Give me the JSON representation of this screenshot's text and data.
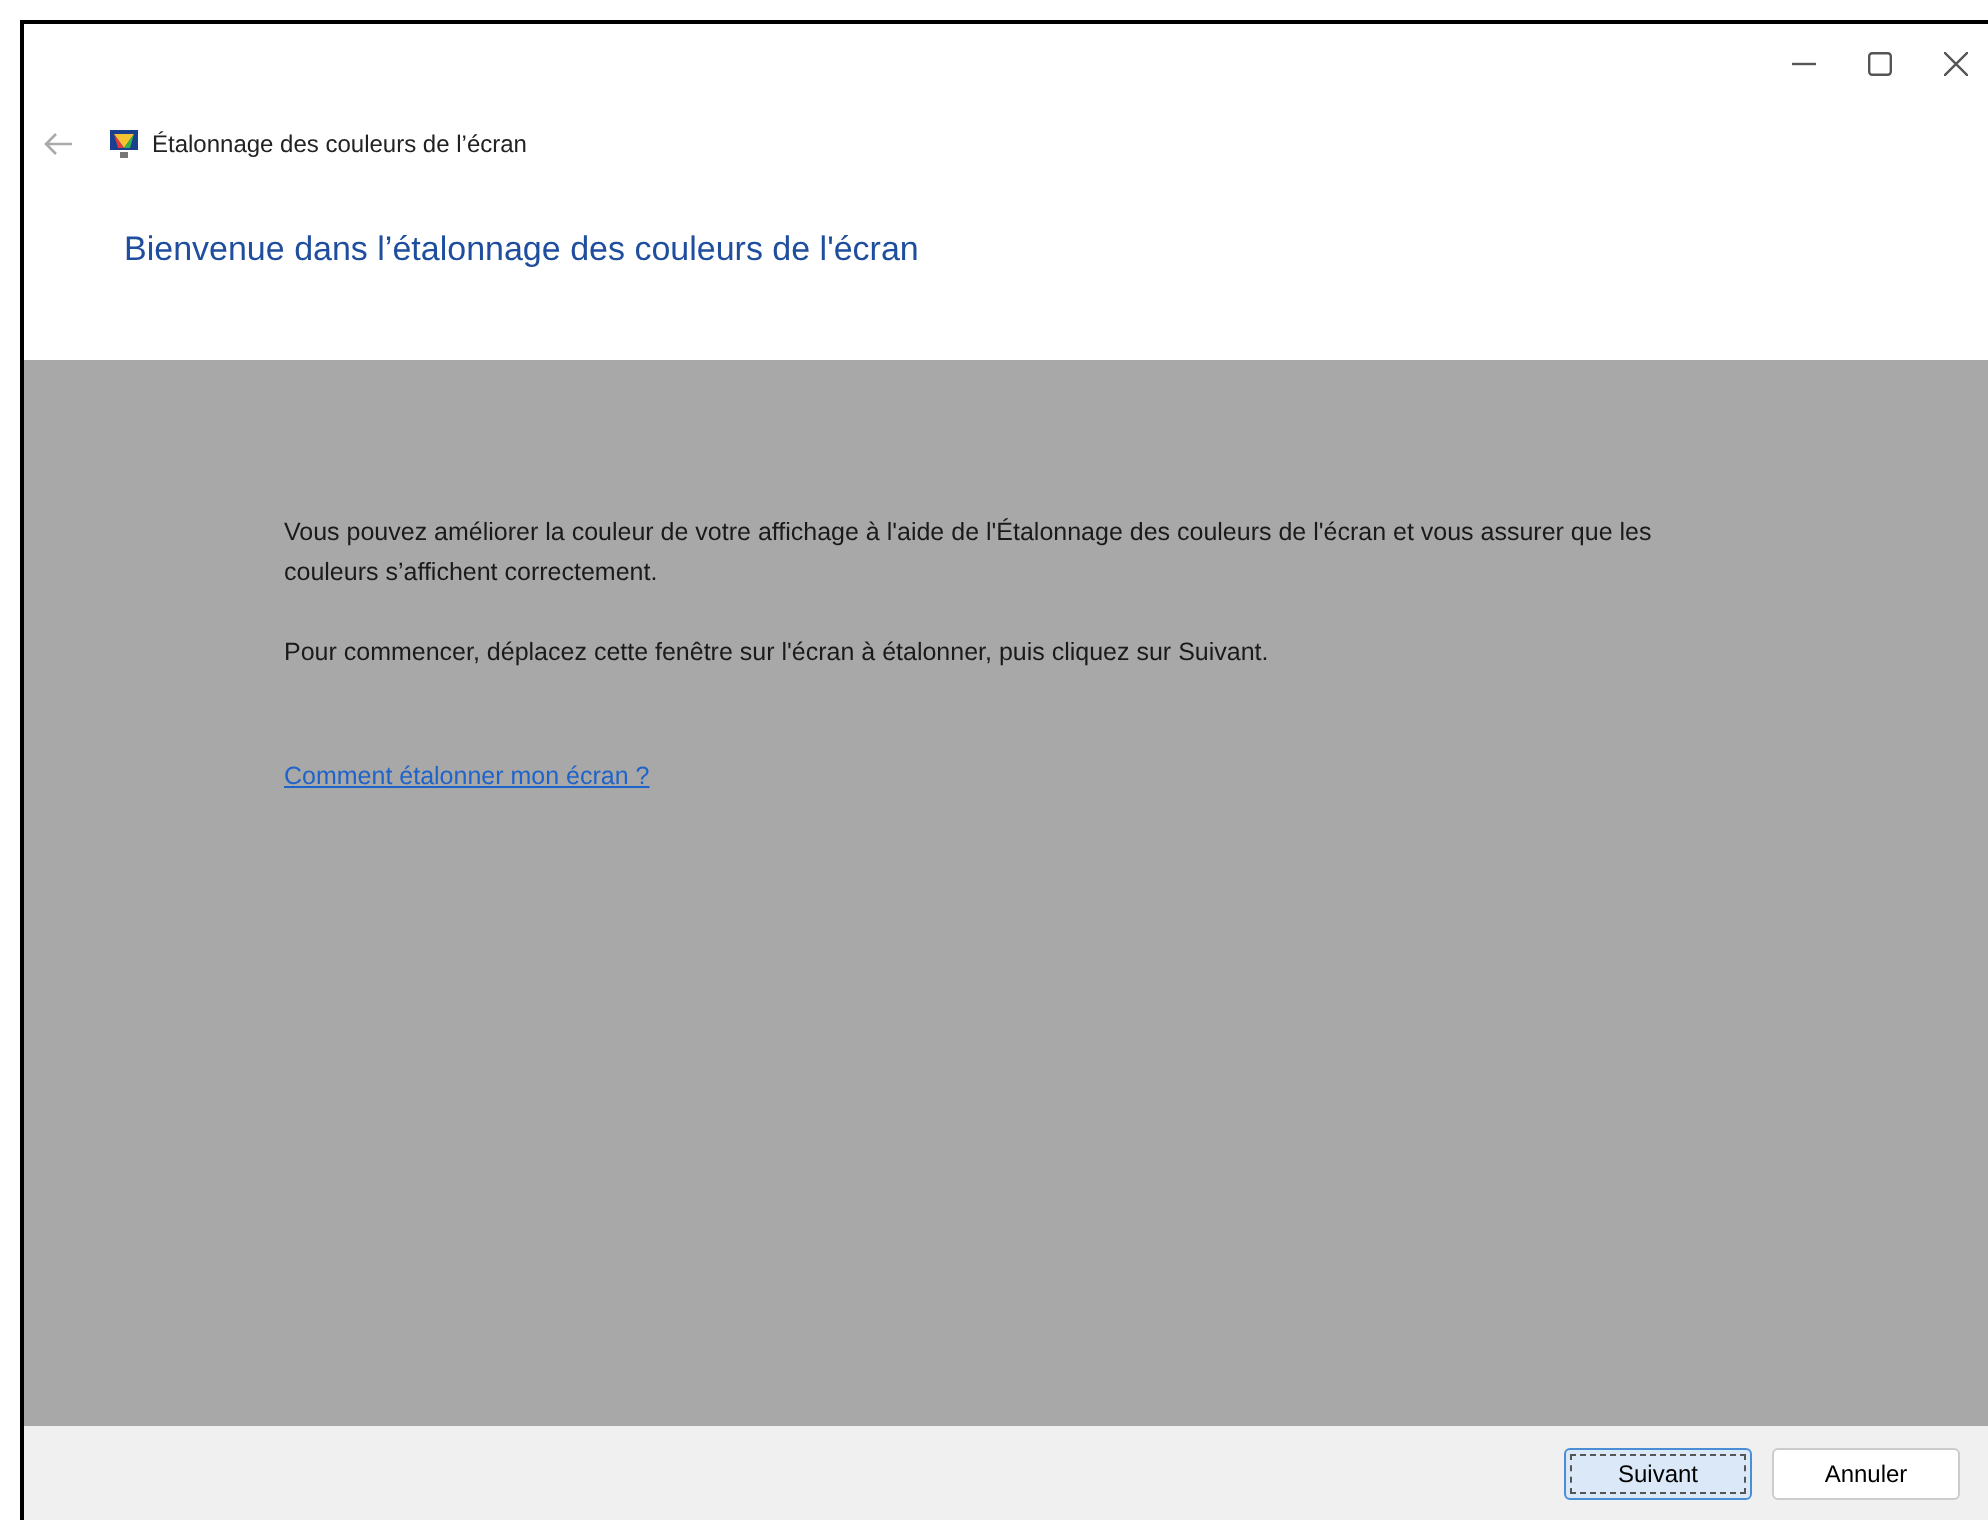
{
  "window": {
    "title": "Étalonnage des couleurs de l’écran"
  },
  "heading": "Bienvenue dans l’étalonnage des couleurs de l'écran",
  "paragraphs": [
    "Vous pouvez améliorer la couleur de votre affichage à l'aide de l'Étalonnage des couleurs de l'écran et vous assurer que les couleurs s’affichent correctement.",
    "Pour commencer, déplacez cette fenêtre sur l'écran à étalonner, puis cliquez sur Suivant."
  ],
  "help_link": "Comment étalonner mon écran ?",
  "buttons": [
    {
      "label": "Suivant",
      "default": true
    },
    {
      "label": "Annuler",
      "default": false
    }
  ]
}
